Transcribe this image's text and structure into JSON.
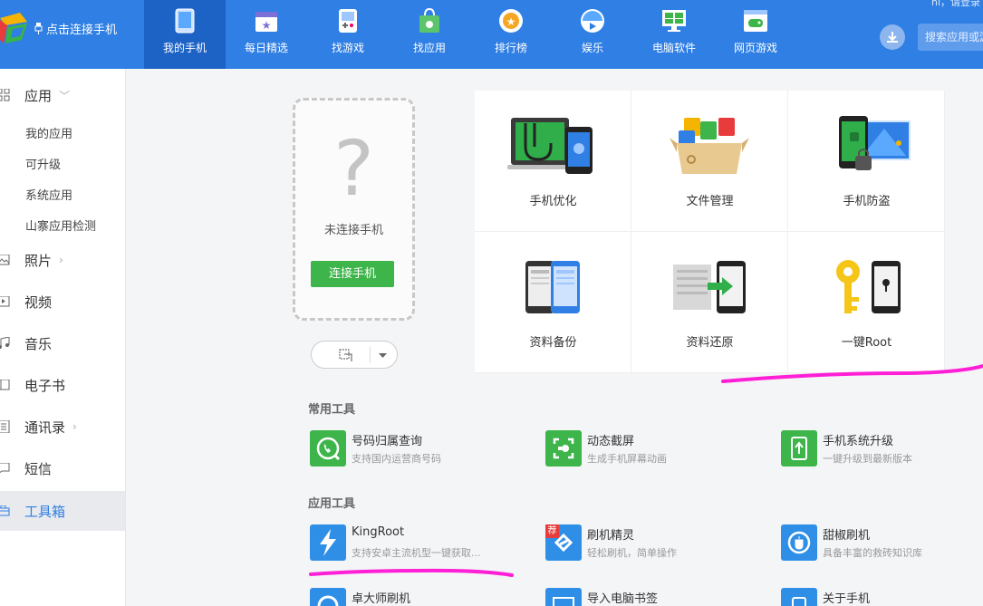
{
  "header": {
    "connect_link": "点击连接手机",
    "greeting": "hi，请登录",
    "search_placeholder": "搜索应用或游戏",
    "nav": [
      {
        "label": "我的手机",
        "icon": "phone-icon",
        "active": true
      },
      {
        "label": "每日精选",
        "icon": "calendar-star-icon"
      },
      {
        "label": "找游戏",
        "icon": "gameboy-icon"
      },
      {
        "label": "找应用",
        "icon": "shopping-bag-icon"
      },
      {
        "label": "排行榜",
        "icon": "medal-icon"
      },
      {
        "label": "娱乐",
        "icon": "media-icon"
      },
      {
        "label": "电脑软件",
        "icon": "monitor-icon"
      },
      {
        "label": "网页游戏",
        "icon": "gamepad-icon"
      }
    ]
  },
  "sidebar": {
    "items": [
      {
        "label": "应用",
        "icon": "grid-icon",
        "arrow": "﹀"
      },
      {
        "label": "照片",
        "icon": "image-icon",
        "arrow": "›"
      },
      {
        "label": "视频",
        "icon": "video-icon"
      },
      {
        "label": "音乐",
        "icon": "music-icon"
      },
      {
        "label": "电子书",
        "icon": "book-icon"
      },
      {
        "label": "通讯录",
        "icon": "contacts-icon",
        "arrow": "›"
      },
      {
        "label": "短信",
        "icon": "message-icon"
      },
      {
        "label": "工具箱",
        "icon": "toolbox-icon",
        "active": true
      }
    ],
    "app_subitems": [
      "我的应用",
      "可升级",
      "系统应用",
      "山寨应用检测"
    ]
  },
  "phone_card": {
    "question_mark": "?",
    "status": "未连接手机",
    "connect_button": "连接手机"
  },
  "features": [
    {
      "label": "手机优化",
      "icon": "stethoscope-icon"
    },
    {
      "label": "文件管理",
      "icon": "file-box-icon"
    },
    {
      "label": "手机防盗",
      "icon": "phone-lock-icon"
    },
    {
      "label": "资料备份",
      "icon": "backup-icon"
    },
    {
      "label": "资料还原",
      "icon": "restore-icon"
    },
    {
      "label": "一键Root",
      "icon": "key-icon"
    }
  ],
  "common_tools": {
    "title": "常用工具",
    "items": [
      {
        "name": "号码归属查询",
        "desc": "支持国内运营商号码",
        "icon": "phone-search-icon",
        "color": "#3db54a"
      },
      {
        "name": "动态截屏",
        "desc": "生成手机屏幕动画",
        "icon": "screen-capture-icon",
        "color": "#3db54a"
      },
      {
        "name": "手机系统升级",
        "desc": "一键升级到最新版本",
        "icon": "system-upgrade-icon",
        "color": "#3db54a"
      }
    ]
  },
  "app_tools": {
    "title": "应用工具",
    "items": [
      {
        "name": "KingRoot",
        "desc": "支持安卓主流机型一键获取...",
        "icon": "lightning-icon",
        "color": "#2f8fe6"
      },
      {
        "name": "刷机精灵",
        "desc": "轻松刷机，简单操作",
        "icon": "flash-wizard-icon",
        "color": "#2f8fe6",
        "badge": "荐"
      },
      {
        "name": "甜椒刷机",
        "desc": "具备丰富的救砖知识库",
        "icon": "pepper-icon",
        "color": "#2f8fe6"
      },
      {
        "name": "卓大师刷机",
        "desc": "",
        "icon": "master-flash-icon",
        "color": "#2f8fe6"
      },
      {
        "name": "导入电脑书签",
        "desc": "",
        "icon": "bookmark-import-icon",
        "color": "#2f8fe6"
      },
      {
        "name": "关于手机",
        "desc": "",
        "icon": "about-phone-icon",
        "color": "#2f8fe6"
      }
    ]
  },
  "colors": {
    "header_bg": "#2f7fe4",
    "active_nav": "#1d63c6",
    "green": "#3db54a",
    "marker": "#ff1fd6"
  }
}
